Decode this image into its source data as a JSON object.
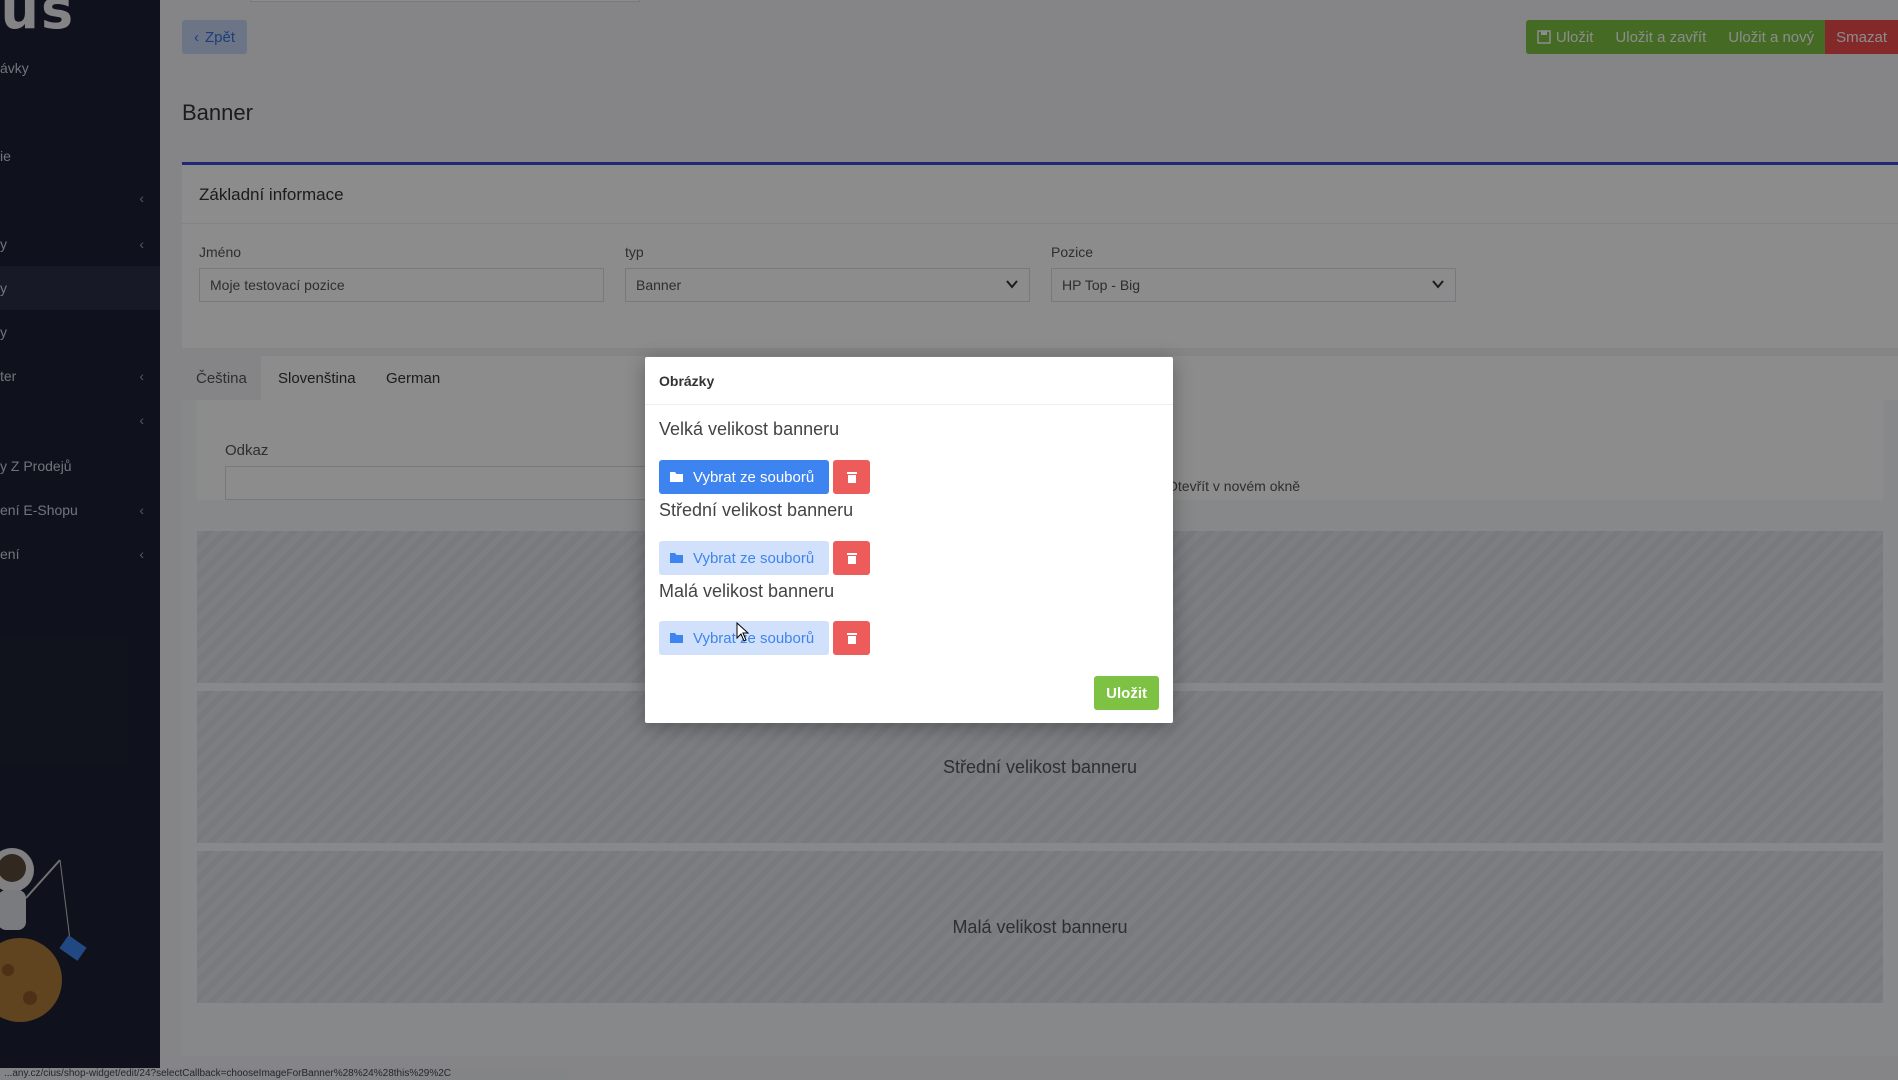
{
  "sidebar": {
    "items": [
      {
        "label": "ávky",
        "chevron": false
      },
      {
        "label": "ie",
        "chevron": false
      },
      {
        "label": "",
        "chevron": true
      },
      {
        "label": "y",
        "chevron": true
      },
      {
        "label": "y",
        "chevron": false,
        "active": true
      },
      {
        "label": "y",
        "chevron": false
      },
      {
        "label": "ter",
        "chevron": true
      },
      {
        "label": "",
        "chevron": true
      },
      {
        "label": "y Z Prodejů",
        "chevron": false
      },
      {
        "label": "ení E-Shopu",
        "chevron": true
      },
      {
        "label": "ení",
        "chevron": true
      }
    ],
    "chevron_glyph": "‹"
  },
  "toolbar": {
    "back_label": "Zpět",
    "save_label": "Uložit",
    "save_close_label": "Uložit a zavřít",
    "save_new_label": "Uložit a nový",
    "delete_label": "Smazat"
  },
  "page": {
    "title": "Banner"
  },
  "basic_info": {
    "title": "Základní informace",
    "name_label": "Jméno",
    "name_value": "Moje testovací pozice",
    "type_label": "typ",
    "type_value": "Banner",
    "position_label": "Pozice",
    "position_value": "HP Top - Big"
  },
  "tabs": [
    {
      "label": "Čeština",
      "active": true
    },
    {
      "label": "Slovenština",
      "active": false
    },
    {
      "label": "German",
      "active": false
    }
  ],
  "tab_content": {
    "link_label": "Odkaz",
    "new_window_label": "Otevřít v novém okně",
    "banner_zones": [
      "",
      "Střední velikost banneru",
      "Malá velikost banneru"
    ]
  },
  "modal": {
    "title": "Obrázky",
    "sections": [
      {
        "label": "Velká velikost banneru",
        "button_label": "Vybrat ze souborů",
        "active": true
      },
      {
        "label": "Střední velikost banneru",
        "button_label": "Vybrat ze souborů",
        "active": false
      },
      {
        "label": "Malá velikost banneru",
        "button_label": "Vybrat ze souborů",
        "active": false
      }
    ],
    "save_label": "Uložit"
  },
  "status_bar": {
    "url": "...any.cz/cius/shop-widget/edit/24?selectCallback=chooseImageForBanner%28%24%28this%29%2C"
  },
  "colors": {
    "sidebar_bg": "#1d2233",
    "primary_blue": "#3e84f0",
    "success_green": "#7dc243",
    "danger_red": "#ee4b4b",
    "accent_indigo": "#3d4bd6"
  }
}
